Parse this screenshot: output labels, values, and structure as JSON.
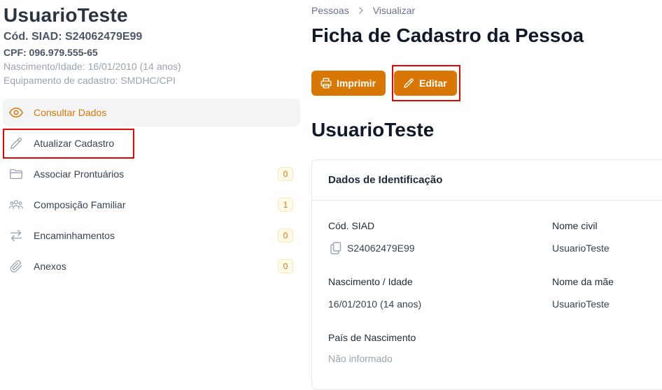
{
  "sidebar": {
    "user_name": "UsuarioTeste",
    "siad": "Cód. SIAD: S24062479E99",
    "cpf": "CPF: 096.979.555-65",
    "birth": "Nascimento/Idade: 16/01/2010 (14 anos)",
    "equipment": "Equipamento de cadastro: SMDHC/CPI",
    "menu": [
      {
        "label": "Consultar Dados",
        "icon": "eye-icon",
        "badge": null,
        "active": true
      },
      {
        "label": "Atualizar Cadastro",
        "icon": "pencil-icon",
        "badge": null,
        "active": false
      },
      {
        "label": "Associar Prontuários",
        "icon": "folder-icon",
        "badge": "0",
        "active": false
      },
      {
        "label": "Composição Familiar",
        "icon": "users-icon",
        "badge": "1",
        "active": false
      },
      {
        "label": "Encaminhamentos",
        "icon": "arrows-exchange-icon",
        "badge": "0",
        "active": false
      },
      {
        "label": "Anexos",
        "icon": "paperclip-icon",
        "badge": "0",
        "active": false
      }
    ]
  },
  "breadcrumb": {
    "parent": "Pessoas",
    "current": "Visualizar"
  },
  "page_title": "Ficha de Cadastro da Pessoa",
  "actions": {
    "print_label": "Imprimir",
    "edit_label": "Editar"
  },
  "person_name": "UsuarioTeste",
  "card": {
    "title": "Dados de Identificação",
    "fields": {
      "siad_label": "Cód. SIAD",
      "siad_value": "S24062479E99",
      "civil_name_label": "Nome civil",
      "civil_name_value": "UsuarioTeste",
      "birth_label": "Nascimento / Idade",
      "birth_value": "16/01/2010 (14 anos)",
      "mother_label": "Nome da mãe",
      "mother_value": "UsuarioTeste",
      "country_label": "País de Nascimento",
      "country_value": "Não informado"
    }
  },
  "colors": {
    "accent": "#d97706",
    "highlight": "#e10600",
    "text_dark": "#111827"
  }
}
